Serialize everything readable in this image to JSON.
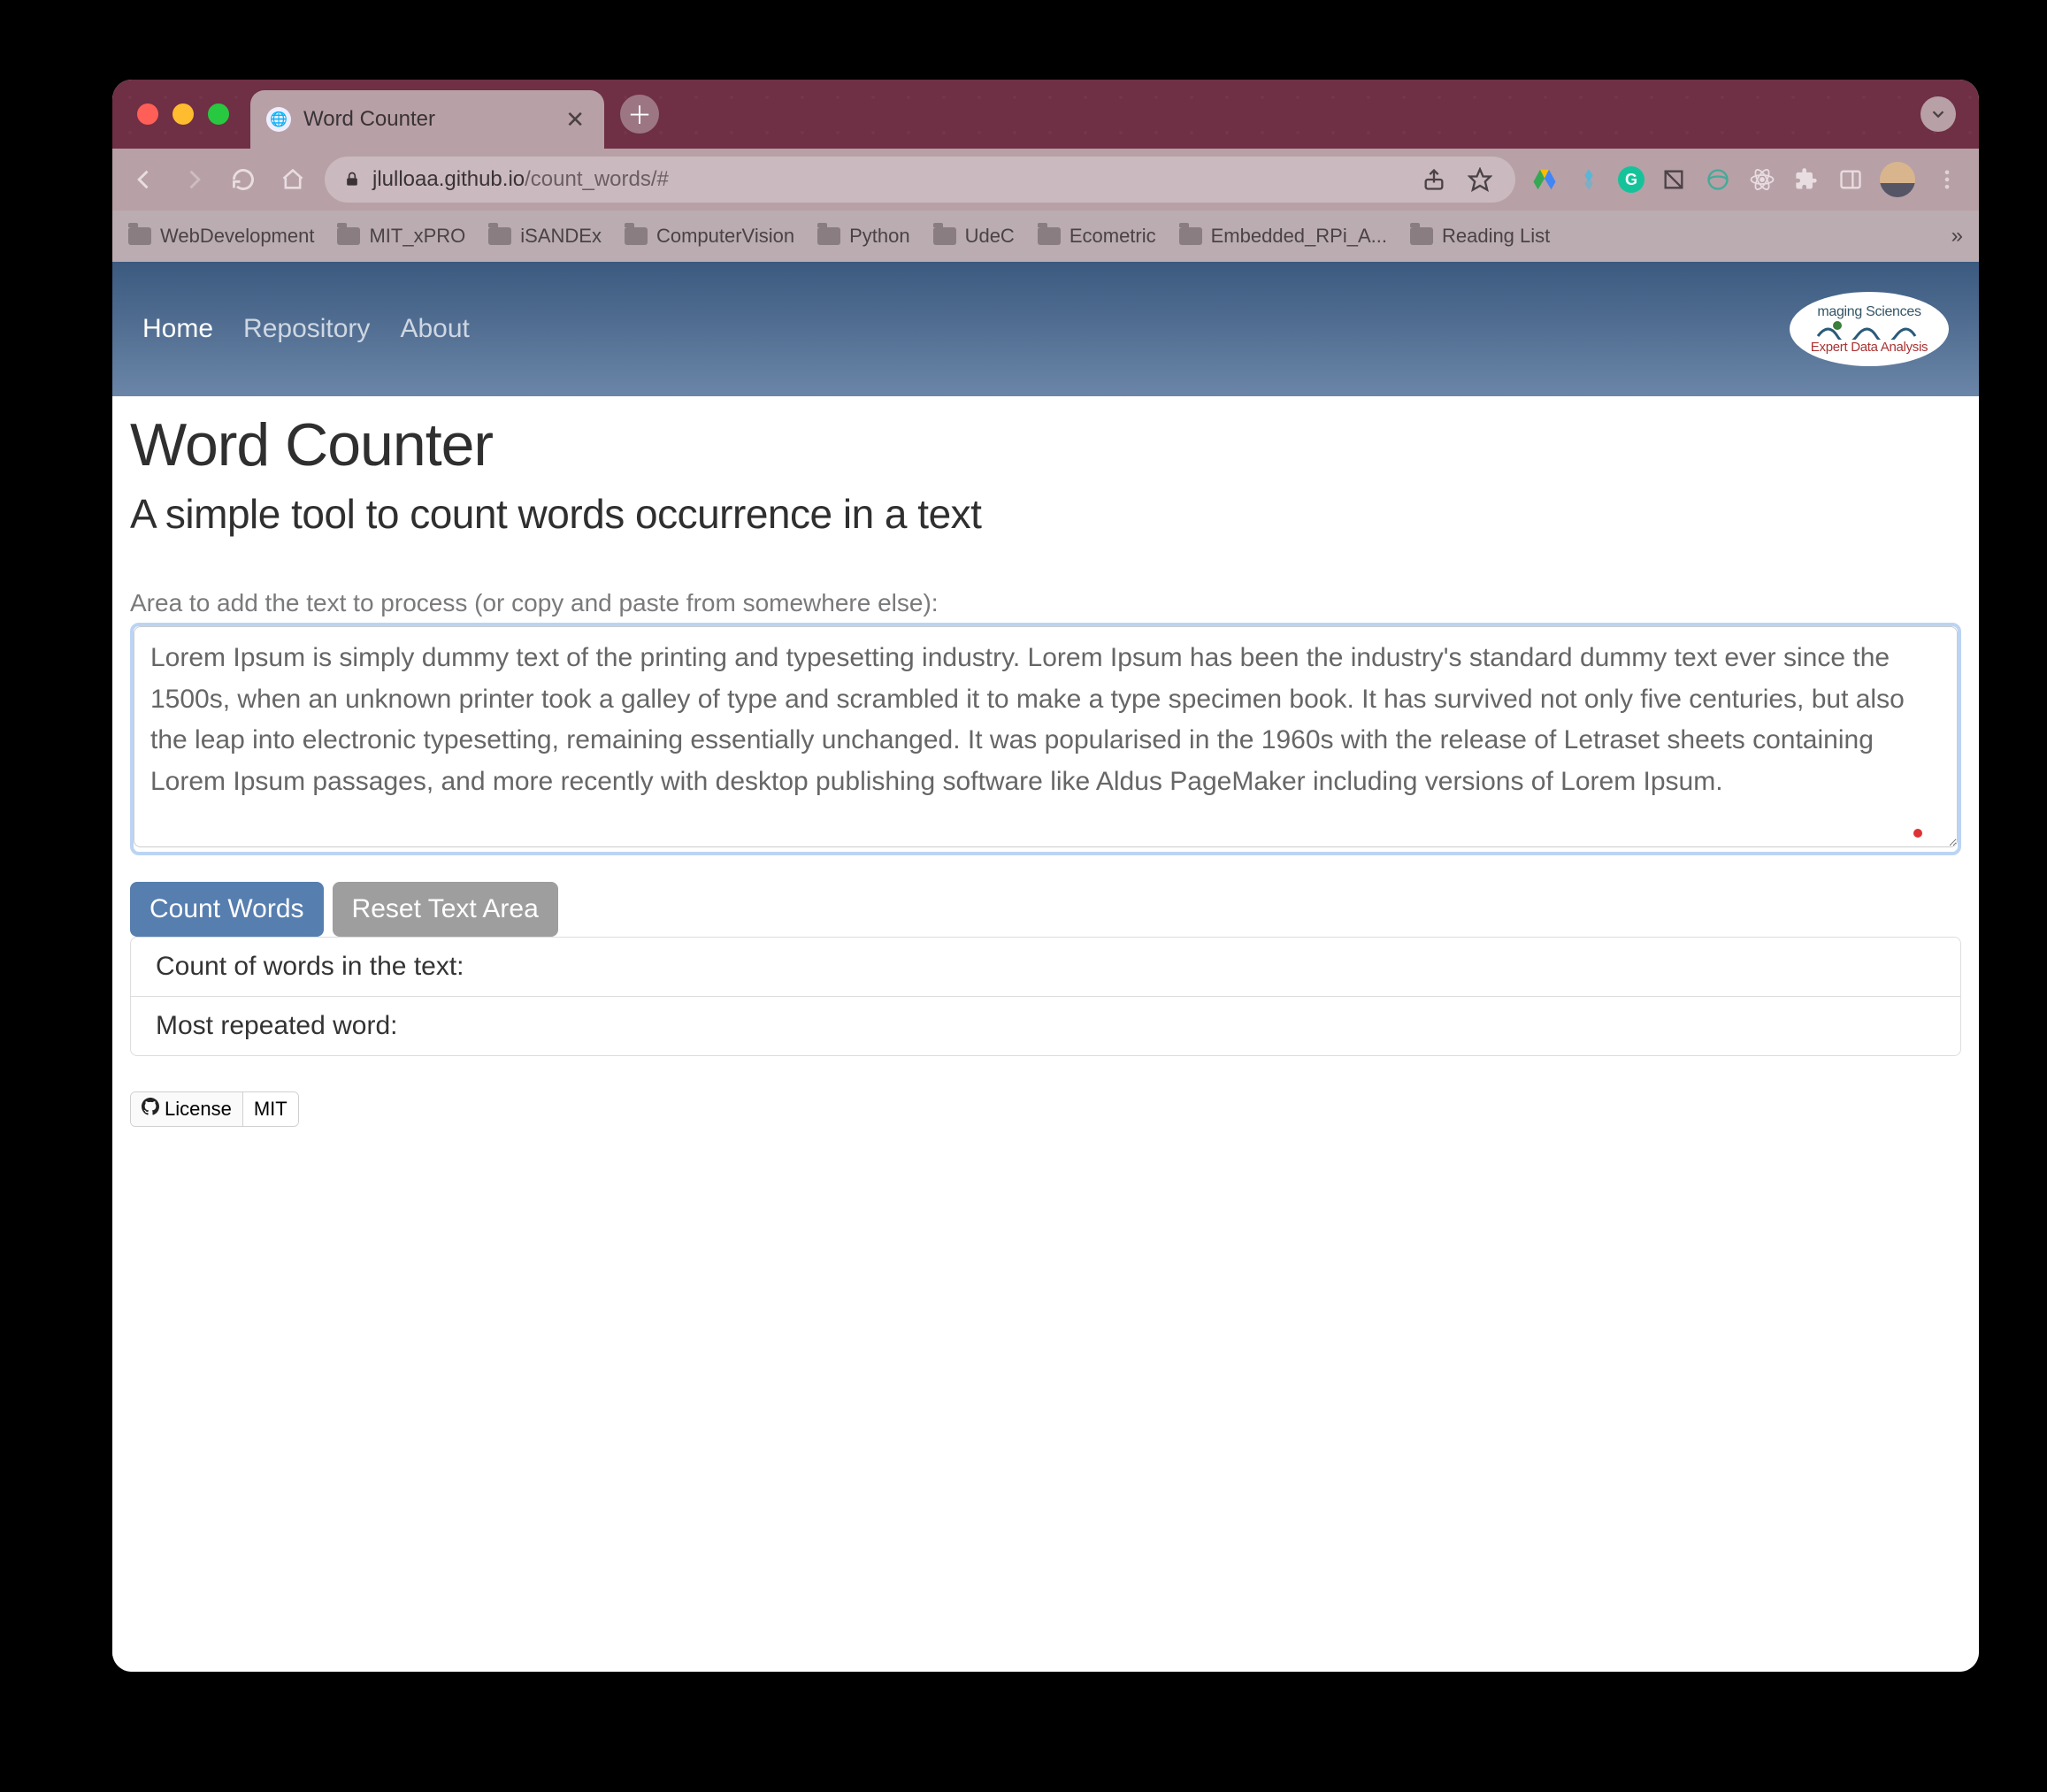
{
  "browser": {
    "tab_title": "Word Counter",
    "url_host": "jlulloaa.github.io",
    "url_path": "/count_words/#",
    "bookmarks": [
      "WebDevelopment",
      "MIT_xPRO",
      "iSANDEx",
      "ComputerVision",
      "Python",
      "UdeC",
      "Ecometric",
      "Embedded_RPi_A...",
      "Reading List"
    ]
  },
  "nav": {
    "items": [
      "Home",
      "Repository",
      "About"
    ],
    "logo_line1": "maging Sciences",
    "logo_line2": "Expert Data Analysis"
  },
  "page": {
    "heading": "Word Counter",
    "subheading": "A simple tool to count words occurrence in a text",
    "textarea_label": "Area to add the text to process (or copy and paste from somewhere else):",
    "textarea_value": "Lorem Ipsum is simply dummy text of the printing and typesetting industry. Lorem Ipsum has been the industry's standard dummy text ever since the 1500s, when an unknown printer took a galley of type and scrambled it to make a type specimen book. It has survived not only five centuries, but also the leap into electronic typesetting, remaining essentially unchanged. It was popularised in the 1960s with the release of Letraset sheets containing Lorem Ipsum passages, and more recently with desktop publishing software like Aldus PageMaker including versions of Lorem Ipsum.",
    "buttons": {
      "count": "Count Words",
      "reset": "Reset Text Area"
    },
    "results": {
      "count_label": "Count of words in the text:",
      "most_label": "Most repeated word:"
    },
    "badge": {
      "left": "License",
      "right": "MIT"
    }
  }
}
